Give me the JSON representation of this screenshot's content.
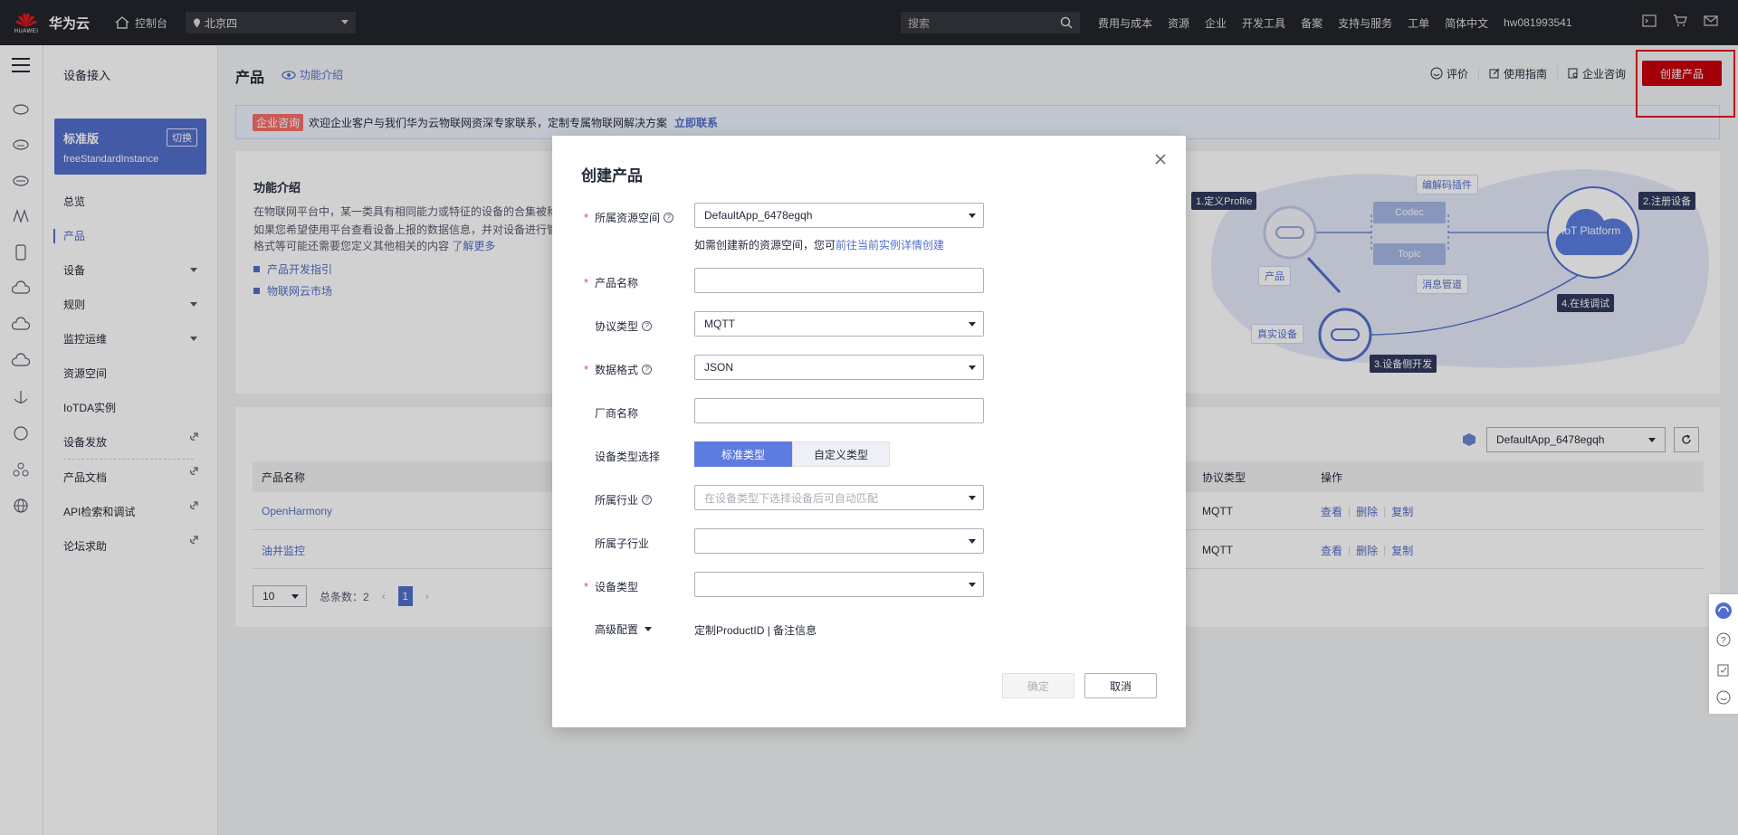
{
  "topnav": {
    "brand": "华为云",
    "logo_text": "HUAWEI",
    "console": "控制台",
    "region": "北京四",
    "search_placeholder": "搜索",
    "menu": [
      "费用与成本",
      "资源",
      "企业",
      "开发工具",
      "备案",
      "支持与服务",
      "工单",
      "简体中文",
      "hw081993541"
    ],
    "icons": [
      "terminal-icon",
      "cart-icon",
      "mail-icon"
    ]
  },
  "sidebar": {
    "title": "设备接入",
    "edition": {
      "name": "标准版",
      "switch": "切换",
      "instance": "freeStandardInstance"
    },
    "items": [
      {
        "label": "总览"
      },
      {
        "label": "产品"
      },
      {
        "label": "设备"
      },
      {
        "label": "规则"
      },
      {
        "label": "监控运维"
      },
      {
        "label": "资源空间"
      },
      {
        "label": "IoTDA实例"
      },
      {
        "label": "设备发放"
      },
      {
        "label": "产品文档"
      },
      {
        "label": "API检索和调试"
      },
      {
        "label": "论坛求助"
      }
    ]
  },
  "main": {
    "title": "产品",
    "intro_link": "功能介绍",
    "actions": {
      "rate": "评价",
      "guide": "使用指南",
      "consult": "企业咨询",
      "create": "创建产品"
    },
    "banner": {
      "tag": "企业咨询",
      "text": "欢迎企业客户与我们华为云物联网资深专家联系，定制专属物联网解决方案",
      "link": "立即联系"
    },
    "intro": {
      "heading": "功能介绍",
      "line1": "在物联网平台中，某一类具有相同能力或特征的设备的合集被称",
      "line2": "如果您希望使用平台查看设备上报的数据信息，并对设备进行管",
      "line3": "格式等可能还需要您定义其他相关的内容",
      "line3_link": "了解更多",
      "bullet1": "产品开发指引",
      "bullet2": "物联网云市场"
    },
    "diagram": {
      "step1": "1.定义Profile",
      "step2": "2.注册设备",
      "step3": "3.设备侧开发",
      "step4": "4.在线调试",
      "codec_plugin": "编解码插件",
      "codec": "Codec",
      "topic": "Topic",
      "msg_pipe": "消息管道",
      "product": "产品",
      "real_device": "真实设备",
      "platform": "IoT Platform"
    },
    "list": {
      "workspace": "DefaultApp_6478egqh",
      "columns": {
        "name": "产品名称",
        "protocol": "协议类型",
        "ops": "操作"
      },
      "rows": [
        {
          "name": "OpenHarmony",
          "protocol": "MQTT",
          "view": "查看",
          "delete": "删除",
          "copy": "复制"
        },
        {
          "name": "油井监控",
          "protocol": "MQTT",
          "view": "查看",
          "delete": "删除",
          "copy": "复制"
        }
      ],
      "pager": {
        "size": "10",
        "total": "总条数：2",
        "current": "1"
      }
    }
  },
  "modal": {
    "title": "创建产品",
    "fields": {
      "workspace": {
        "label": "所属资源空间",
        "value": "DefaultApp_6478egqh",
        "hint": "如需创建新的资源空间，您可",
        "hint_link": "前往当前实例详情创建"
      },
      "name": {
        "label": "产品名称",
        "value": ""
      },
      "protocol": {
        "label": "协议类型",
        "value": "MQTT"
      },
      "format": {
        "label": "数据格式",
        "value": "JSON"
      },
      "vendor": {
        "label": "厂商名称",
        "value": ""
      },
      "type_select": {
        "label": "设备类型选择",
        "standard": "标准类型",
        "custom": "自定义类型"
      },
      "industry": {
        "label": "所属行业",
        "placeholder": "在设备类型下选择设备后可自动匹配"
      },
      "sub_industry": {
        "label": "所属子行业",
        "value": ""
      },
      "device_type": {
        "label": "设备类型",
        "value": ""
      },
      "advanced": {
        "label": "高级配置",
        "value": "定制ProductID | 备注信息"
      }
    },
    "ok": "确定",
    "cancel": "取消"
  }
}
